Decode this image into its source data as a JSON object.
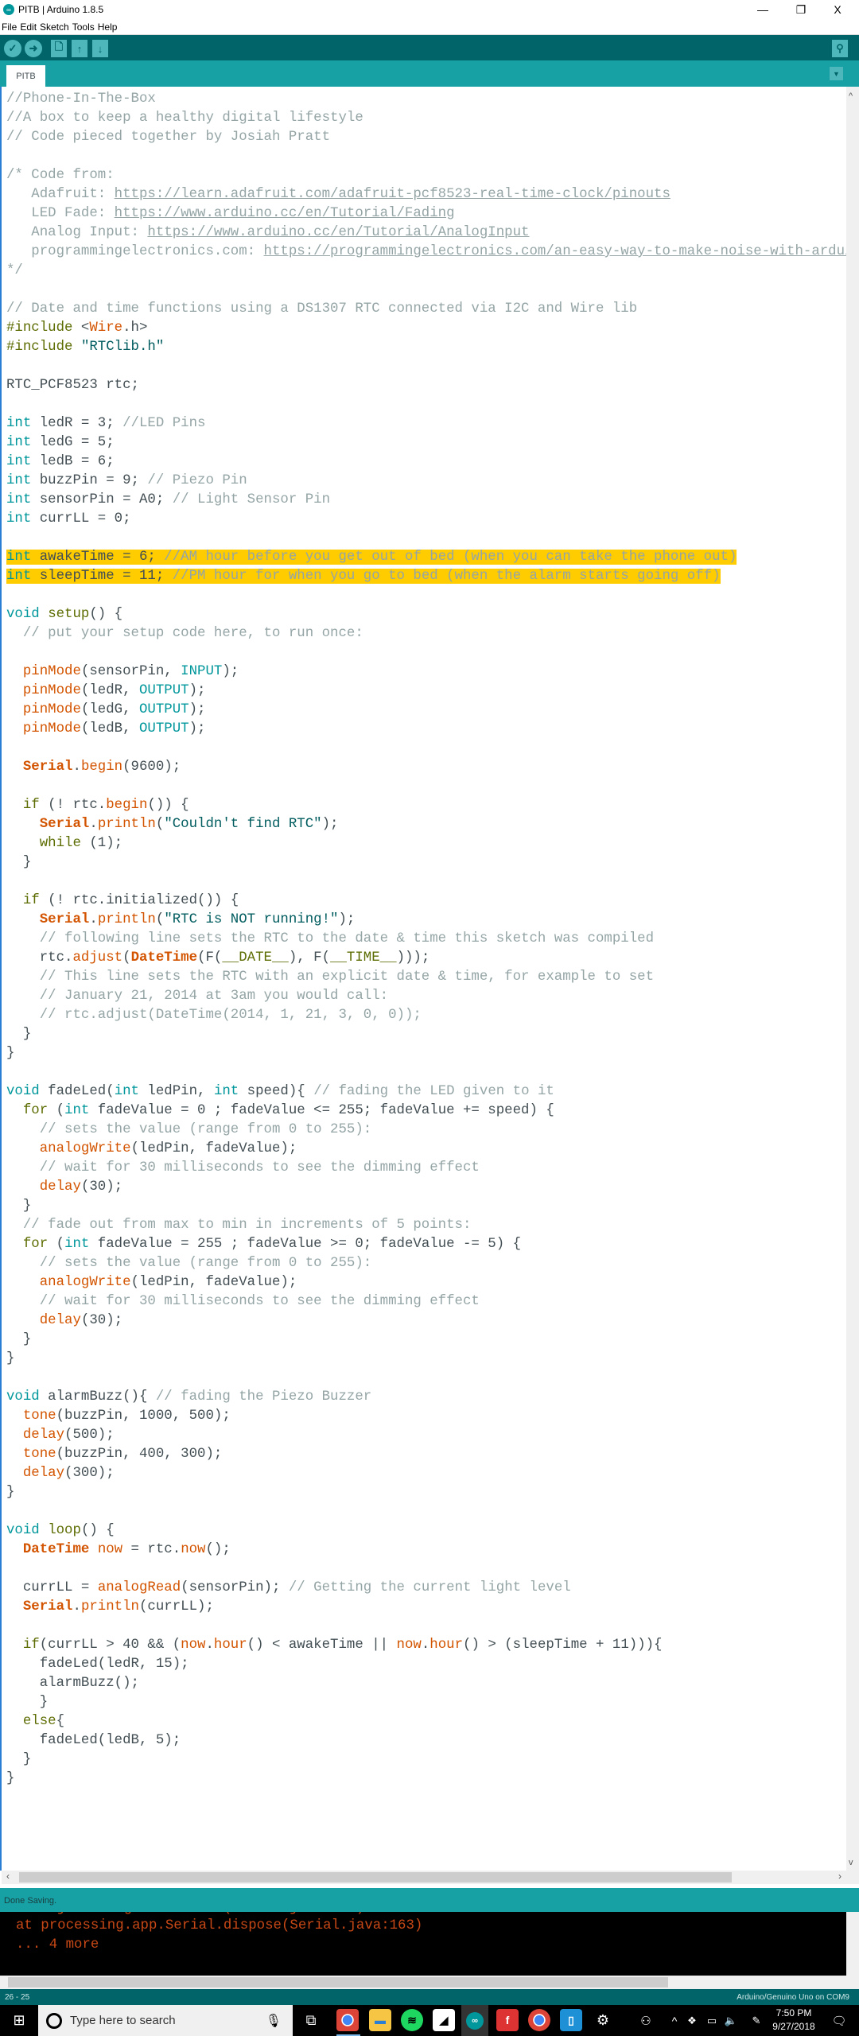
{
  "window": {
    "title": "PITB | Arduino 1.8.5",
    "minimize": "—",
    "maximize": "❐",
    "close": "X"
  },
  "menu": [
    "File",
    "Edit",
    "Sketch",
    "Tools",
    "Help"
  ],
  "toolbar": {
    "verify_icon": "✓",
    "upload_icon": "➜",
    "new_icon": "🗋",
    "open_icon": "↑",
    "save_icon": "↓",
    "serial_monitor_icon": "⚲"
  },
  "tabs": [
    {
      "label": "PITB",
      "active": true
    }
  ],
  "tab_menu_icon": "▼",
  "editor": {
    "highlighted_lines": [
      25,
      26
    ],
    "lines": [
      "//Phone-In-The-Box",
      "//A box to keep a healthy digital lifestyle",
      "// Code pieced together by Josiah Pratt",
      "",
      "/* Code from:",
      "   Adafruit: https://learn.adafruit.com/adafruit-pcf8523-real-time-clock/pinouts",
      "   LED Fade: https://www.arduino.cc/en/Tutorial/Fading",
      "   Analog Input: https://www.arduino.cc/en/Tutorial/AnalogInput",
      "   programmingelectronics.com: https://programmingelectronics.com/an-easy-way-to-make-noise-with-arduino",
      "*/",
      "",
      "// Date and time functions using a DS1307 RTC connected via I2C and Wire lib",
      "#include <Wire.h>",
      "#include \"RTClib.h\"",
      "",
      "RTC_PCF8523 rtc;",
      "",
      "int ledR = 3; //LED Pins",
      "int ledG = 5;",
      "int ledB = 6;",
      "int buzzPin = 9; // Piezo Pin",
      "int sensorPin = A0; // Light Sensor Pin",
      "int currLL = 0;",
      "",
      "int awakeTime = 6; //AM hour before you get out of bed (when you can take the phone out)",
      "int sleepTime = 11; //PM hour for when you go to bed (when the alarm starts going off)",
      "",
      "void setup() {",
      "  // put your setup code here, to run once:",
      "",
      "  pinMode(sensorPin, INPUT);",
      "  pinMode(ledR, OUTPUT);",
      "  pinMode(ledG, OUTPUT);",
      "  pinMode(ledB, OUTPUT);",
      "",
      "  Serial.begin(9600);",
      "",
      "  if (! rtc.begin()) {",
      "    Serial.println(\"Couldn't find RTC\");",
      "    while (1);",
      "  }",
      "",
      "  if (! rtc.initialized()) {",
      "    Serial.println(\"RTC is NOT running!\");",
      "    // following line sets the RTC to the date & time this sketch was compiled",
      "    rtc.adjust(DateTime(F(__DATE__), F(__TIME__)));",
      "    // This line sets the RTC with an explicit date & time, for example to set",
      "    // January 21, 2014 at 3am you would call:",
      "    // rtc.adjust(DateTime(2014, 1, 21, 3, 0, 0));",
      "  }",
      "}",
      "",
      "void fadeLed(int ledPin, int speed){ // fading the LED given to it",
      "  for (int fadeValue = 0 ; fadeValue <= 255; fadeValue += speed) {",
      "    // sets the value (range from 0 to 255):",
      "    analogWrite(ledPin, fadeValue);",
      "    // wait for 30 milliseconds to see the dimming effect",
      "    delay(30);",
      "  }",
      "  // fade out from max to min in increments of 5 points:",
      "  for (int fadeValue = 255 ; fadeValue >= 0; fadeValue -= 5) {",
      "    // sets the value (range from 0 to 255):",
      "    analogWrite(ledPin, fadeValue);",
      "    // wait for 30 milliseconds to see the dimming effect",
      "    delay(30);",
      "  }",
      "}",
      "",
      "void alarmBuzz(){ // fading the Piezo Buzzer",
      "  tone(buzzPin, 1000, 500);",
      "  delay(500);",
      "  tone(buzzPin, 400, 300);",
      "  delay(300);",
      "}",
      "",
      "void loop() {",
      "  DateTime now = rtc.now();",
      "",
      "  currLL = analogRead(sensorPin); // Getting the current light level",
      "  Serial.println(currLL);",
      "",
      "  if(currLL > 40 && (now.hour() < awakeTime || now.hour() > (sleepTime + 11))){",
      "    fadeLed(ledR, 15);",
      "    alarmBuzz();",
      "    }",
      "  else{",
      "    fadeLed(ledB, 5);",
      "  }",
      "}"
    ]
  },
  "status": {
    "message": "Done Saving."
  },
  "console": {
    "lines": [
      "at processing.app.Serial.dispose(Serial.java:163)",
      "... 4 more"
    ]
  },
  "bottom_bar": {
    "cursor": "26 - 25",
    "board": "Arduino/Genuino Uno on COM9"
  },
  "taskbar": {
    "search_placeholder": "Type here to search",
    "time": "7:50 PM",
    "date": "9/27/2018",
    "apps": [
      "chrome-icon",
      "file-explorer-icon",
      "spotify-icon",
      "notes-icon",
      "arduino-icon",
      "fotor-icon",
      "chrome-icon",
      "app-icon",
      "settings-icon"
    ]
  },
  "colors": {
    "toolbar": "#006468",
    "tabbar": "#17A1A5",
    "highlight": "#FFCC00",
    "console_text": "#C74816"
  }
}
